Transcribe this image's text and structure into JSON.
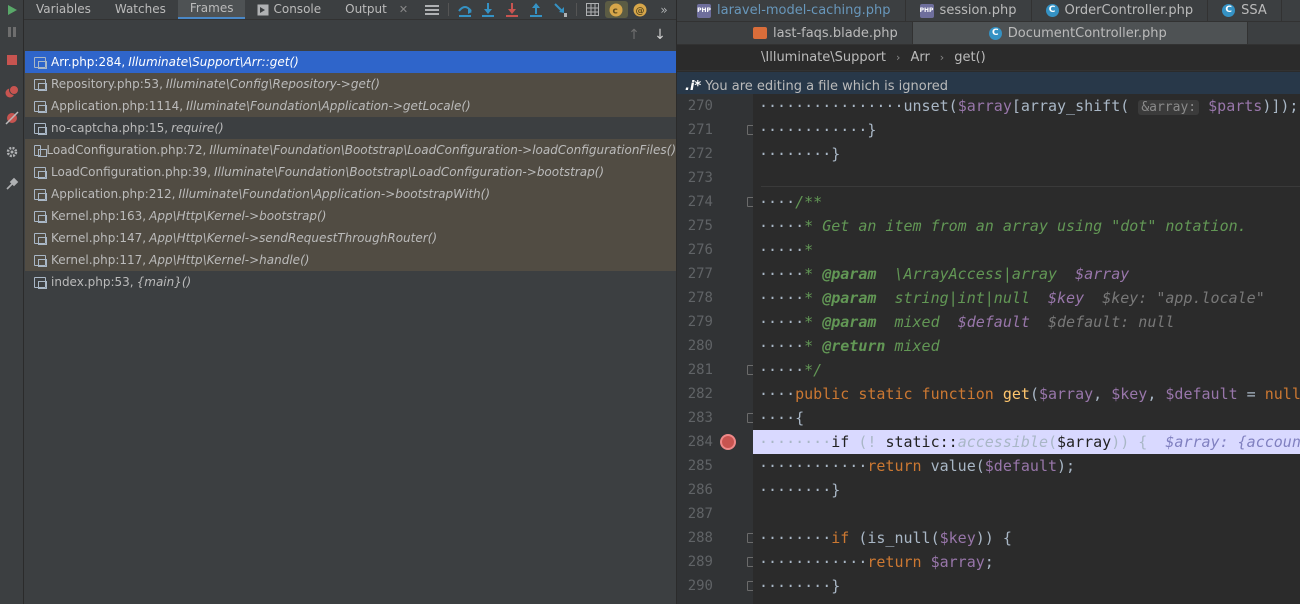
{
  "debugger": {
    "tabs": [
      {
        "label": "Variables"
      },
      {
        "label": "Watches"
      },
      {
        "label": "Frames"
      },
      {
        "label": "Console"
      },
      {
        "label": "Output"
      }
    ],
    "frames": [
      {
        "file": "Arr.php:284,",
        "method": "Illuminate\\Support\\Arr::get()"
      },
      {
        "file": "Repository.php:53,",
        "method": "Illuminate\\Config\\Repository->get()"
      },
      {
        "file": "Application.php:1114,",
        "method": "Illuminate\\Foundation\\Application->getLocale()"
      },
      {
        "file": "no-captcha.php:15,",
        "method": "require()"
      },
      {
        "file": "LoadConfiguration.php:72,",
        "method": "Illuminate\\Foundation\\Bootstrap\\LoadConfiguration->loadConfigurationFiles()"
      },
      {
        "file": "LoadConfiguration.php:39,",
        "method": "Illuminate\\Foundation\\Bootstrap\\LoadConfiguration->bootstrap()"
      },
      {
        "file": "Application.php:212,",
        "method": "Illuminate\\Foundation\\Application->bootstrapWith()"
      },
      {
        "file": "Kernel.php:163,",
        "method": "App\\Http\\Kernel->bootstrap()"
      },
      {
        "file": "Kernel.php:147,",
        "method": "App\\Http\\Kernel->sendRequestThroughRouter()"
      },
      {
        "file": "Kernel.php:117,",
        "method": "App\\Http\\Kernel->handle()"
      },
      {
        "file": "index.php:53,",
        "method": "{main}()"
      }
    ]
  },
  "editor": {
    "tabs_row1": [
      {
        "label": "laravel-model-caching.php"
      },
      {
        "label": "session.php"
      },
      {
        "label": "OrderController.php"
      },
      {
        "label": "SSA"
      }
    ],
    "tabs_row2": [
      {
        "label": "last-faqs.blade.php"
      },
      {
        "label": "DocumentController.php"
      }
    ],
    "breadcrumb": [
      "\\Illuminate\\Support",
      "Arr",
      "get()"
    ],
    "banner": {
      "marker": ".i*",
      "text": "You are editing a file which is ignored"
    },
    "line_numbers": [
      "270",
      "271",
      "272",
      "273",
      "274",
      "275",
      "276",
      "277",
      "278",
      "279",
      "280",
      "281",
      "282",
      "283",
      "284",
      "285",
      "286",
      "287",
      "288",
      "289",
      "290"
    ]
  }
}
